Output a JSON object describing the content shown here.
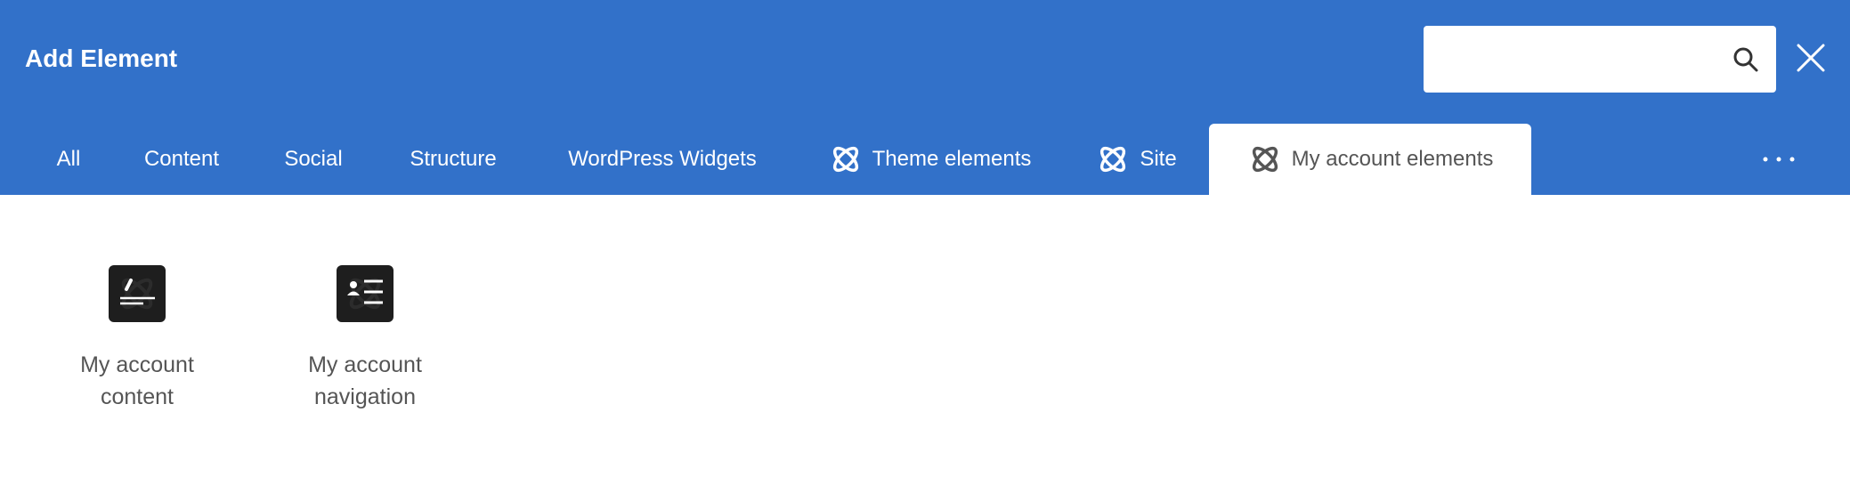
{
  "header": {
    "title": "Add Element",
    "background_color": "#3271c9",
    "search": {
      "value": "",
      "placeholder": "",
      "icon": "search-icon"
    },
    "close_icon": "close-icon"
  },
  "tabs": [
    {
      "label": "All",
      "icon": null,
      "active": false
    },
    {
      "label": "Content",
      "icon": null,
      "active": false
    },
    {
      "label": "Social",
      "icon": null,
      "active": false
    },
    {
      "label": "Structure",
      "icon": null,
      "active": false
    },
    {
      "label": "WordPress Widgets",
      "icon": null,
      "active": false
    },
    {
      "label": "Theme elements",
      "icon": "atom-icon",
      "active": false
    },
    {
      "label": "Site",
      "icon": "atom-icon",
      "active": false
    },
    {
      "label": "My account elements",
      "icon": "atom-icon",
      "active": true
    }
  ],
  "more_icon": "more-horizontal-icon",
  "elements": [
    {
      "label_line1": "My account",
      "label_line2": "content",
      "icon": "account-content-icon"
    },
    {
      "label_line1": "My account",
      "label_line2": "navigation",
      "icon": "account-navigation-icon"
    }
  ],
  "colors": {
    "header_blue": "#3271c9",
    "active_tab_text": "#555555",
    "element_icon_bg": "#1e1e1e"
  }
}
